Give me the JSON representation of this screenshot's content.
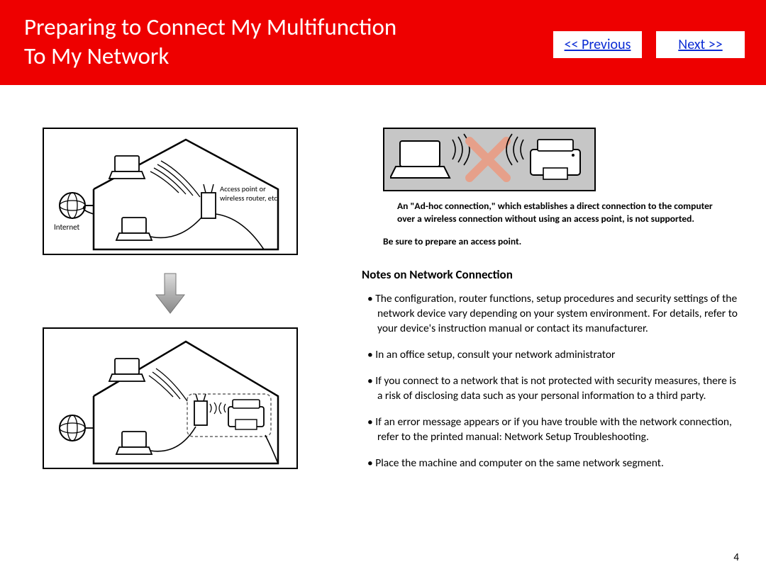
{
  "header": {
    "title_line1": "Preparing to Connect My Multifunction",
    "title_line2": "To My Network"
  },
  "nav": {
    "previous": "<< Previous",
    "next": "Next >>"
  },
  "diagram_labels": {
    "internet": "Internet",
    "access_point": "Access point or\nwireless router, etc."
  },
  "adhoc": {
    "warning": "An \"Ad-hoc connection,\" which establishes a direct connection to the computer over a wireless connection without using an access point, is not supported.",
    "prepare": "Be sure to prepare an access point."
  },
  "notes_heading": "Notes on Network Connection",
  "notes": [
    "The configuration, router functions, setup procedures and security settings of the network device vary depending on your system environment. For details, refer to your device's instruction manual or contact its manufacturer.",
    "In an office setup, consult your network administrator",
    "If you connect to a network that is not protected with security measures, there is a risk of disclosing data such as your personal information to a third party.",
    "If an error message appears or if you have trouble with the network connection, refer to the printed manual: Network Setup Troubleshooting.",
    "Place the machine and computer on the same network segment."
  ],
  "page_number": "4"
}
